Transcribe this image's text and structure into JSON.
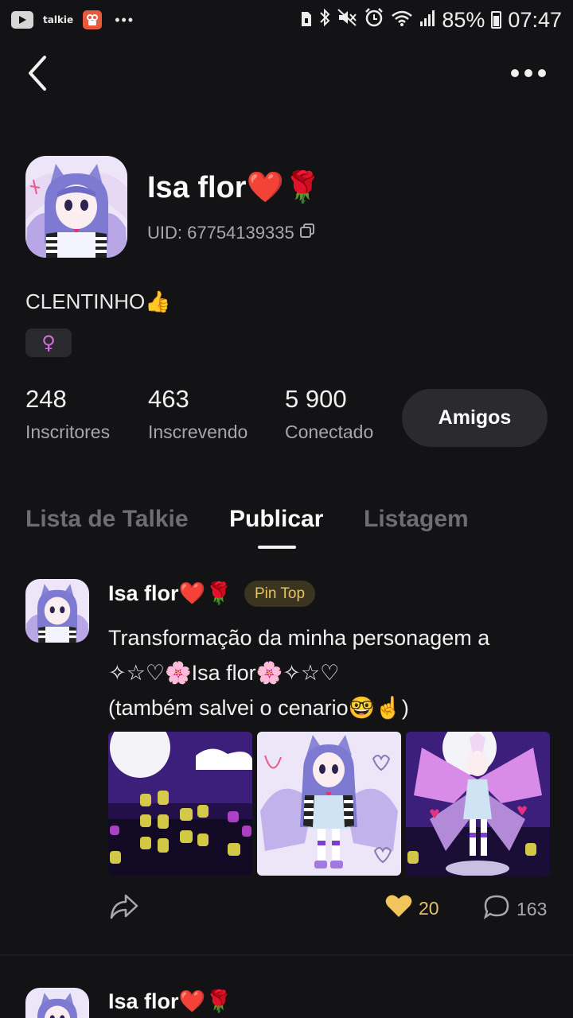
{
  "status_bar": {
    "apps": [
      "youtube-icon",
      "talkie-app-icon",
      "kuaishou-icon"
    ],
    "talkie_label": "talkie",
    "battery_text": "85%",
    "time": "07:47"
  },
  "profile": {
    "name": "Isa flor❤️🌹",
    "uid": "UID: 67754139335",
    "bio": "CLENTINHO👍",
    "gender_symbol": "♀",
    "stats": [
      {
        "value": "248",
        "label": "Inscritores"
      },
      {
        "value": "463",
        "label": "Inscrevendo"
      },
      {
        "value": "5 900",
        "label": "Conectado"
      }
    ],
    "friends_button": "Amigos"
  },
  "tabs": [
    {
      "label": "Lista de Talkie",
      "active": false
    },
    {
      "label": "Publicar",
      "active": true
    },
    {
      "label": "Listagem",
      "active": false
    }
  ],
  "post": {
    "author": "Isa flor❤️🌹",
    "badge": "Pin Top",
    "text_lines": [
      "Transformação da minha personagem a",
      "✧☆♡🌸Isa flor🌸✧☆♡",
      "(também salvei o cenario🤓☝️)"
    ],
    "likes": "20",
    "comments": "163"
  },
  "next_post": {
    "author": "Isa flor❤️🌹"
  },
  "colors": {
    "background": "#131315",
    "pin_text": "#e7c462",
    "like": "#f2c55c",
    "gender": "#d86ae0"
  }
}
